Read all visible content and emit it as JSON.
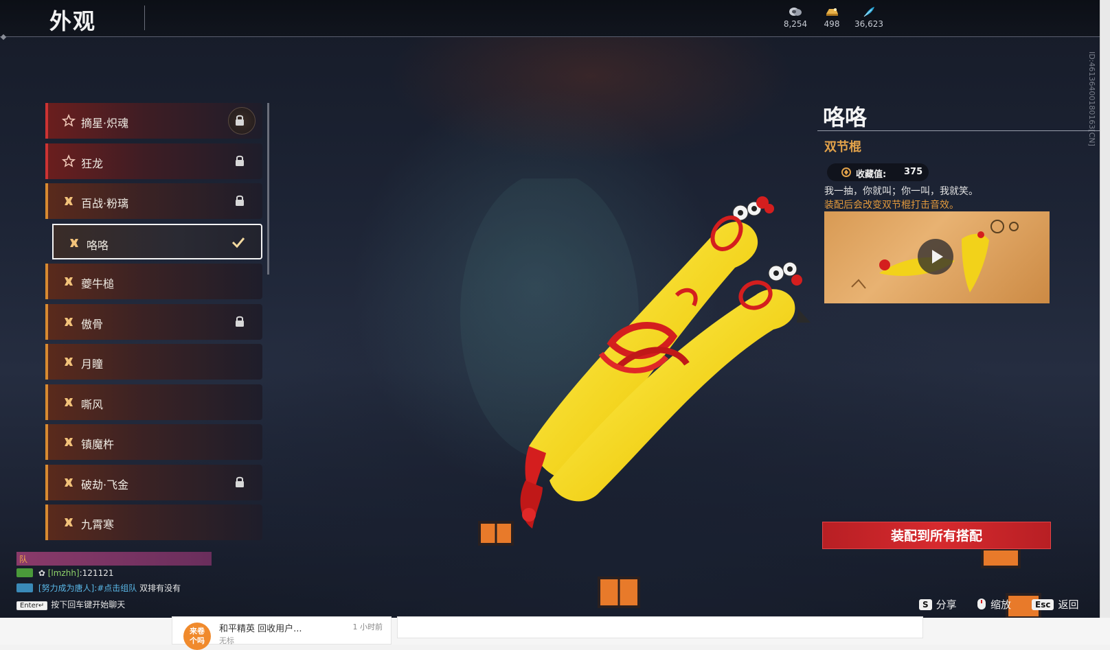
{
  "header": {
    "title": "外观",
    "currencies": [
      {
        "icon": "silver-coin-icon",
        "value": "8,254"
      },
      {
        "icon": "gold-ingot-icon",
        "value": "498"
      },
      {
        "icon": "feather-icon",
        "value": "36,623"
      }
    ]
  },
  "skins": [
    {
      "name": "摘星·炽魂",
      "rarity": "red",
      "icon": "star-icon",
      "locked": true,
      "selected": false
    },
    {
      "name": "狂龙",
      "rarity": "red",
      "icon": "star-icon",
      "locked": true,
      "selected": false
    },
    {
      "name": "百战·粉璃",
      "rarity": "orange",
      "icon": "cross-icon",
      "locked": true,
      "selected": false
    },
    {
      "name": "咯咯",
      "rarity": "orange",
      "icon": "cross-icon",
      "locked": false,
      "selected": true
    },
    {
      "name": "夔牛槌",
      "rarity": "orange",
      "icon": "cross-icon",
      "locked": false,
      "selected": false
    },
    {
      "name": "傲骨",
      "rarity": "orange",
      "icon": "cross-icon",
      "locked": true,
      "selected": false
    },
    {
      "name": "月瞳",
      "rarity": "orange",
      "icon": "cross-icon",
      "locked": false,
      "selected": false
    },
    {
      "name": "嘶风",
      "rarity": "orange",
      "icon": "cross-icon",
      "locked": false,
      "selected": false
    },
    {
      "name": "镇魔杵",
      "rarity": "orange",
      "icon": "cross-icon",
      "locked": false,
      "selected": false
    },
    {
      "name": "破劫·飞金",
      "rarity": "orange",
      "icon": "cross-icon",
      "locked": true,
      "selected": false
    },
    {
      "name": "九霄寒",
      "rarity": "orange",
      "icon": "cross-icon",
      "locked": false,
      "selected": false
    }
  ],
  "detail": {
    "name": "咯咯",
    "type": "双节棍",
    "collect_label": "收藏值:",
    "collect_value": "375",
    "desc": "我一抽，你就叫；你一叫，我就笑。",
    "effect": "装配后会改变双节棍打击音效。",
    "equip_label": "装配到所有搭配",
    "id_text": "ID:4613640018016​3[CN]"
  },
  "hints": {
    "share_key": "S",
    "share_label": "分享",
    "zoom_label": "缩放",
    "back_key": "Esc",
    "back_label": "返回"
  },
  "chat": {
    "team_label": "队",
    "line1_name": "[lmzhh]",
    "line1_text": ":121121",
    "line2_name": "[努力成为唐人]",
    "line2_tag": ":#点击组队",
    "line2_text": " 双排有没有",
    "enter_key": "Enter↵",
    "hint": "按下回车键开始聊天"
  },
  "below": {
    "avatar_text": "来卷\n个吗",
    "title": "和平精英 回收用户...",
    "time": "1 小时前",
    "sub": "无标"
  },
  "colors": {
    "accent_red": "#d62a2e",
    "accent_orange": "#e2a24a",
    "rarity_red": "#cc3333",
    "rarity_orange": "#d88a30"
  }
}
